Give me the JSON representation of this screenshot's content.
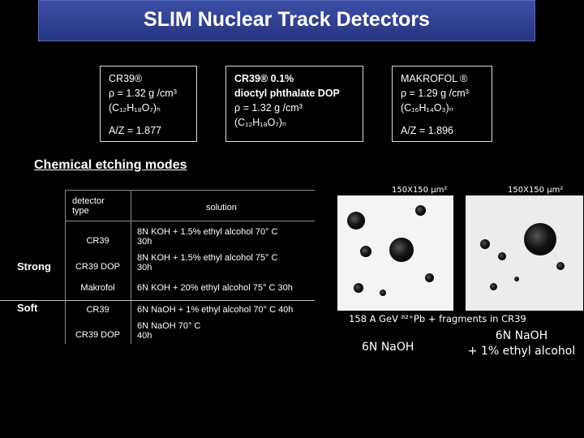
{
  "title": "SLIM Nuclear Track Detectors",
  "materials": [
    {
      "lines": [
        "CR39®",
        "ρ = 1.32 g /cm³",
        "(C₁₂H₁₈O₇)ₙ",
        "",
        "A/Z = 1.877"
      ]
    },
    {
      "lines": [
        "CR39® 0.1%",
        "dioctyl phthalate DOP",
        "ρ = 1.32 g /cm³",
        "(C₁₂H₁₈O₇)ₙ"
      ]
    },
    {
      "lines": [
        "MAKROFOL ®",
        "ρ = 1.29 g /cm³",
        "(C₁₆H₁₄O₃)ₙ",
        "",
        "A/Z = 1.896"
      ]
    }
  ],
  "etching_heading": "Chemical etching modes",
  "table": {
    "header_detector": "detector\ntype",
    "header_solution": "solution",
    "groups": [
      "Strong",
      "Soft"
    ],
    "rows": [
      {
        "detector": "CR39",
        "solution": "8N KOH + 1.5% ethyl alcohol 70° C\n30h"
      },
      {
        "detector": "CR39 DOP",
        "solution": "8N KOH + 1.5% ethyl alcohol 75° C\n30h"
      },
      {
        "detector": "Makrofol",
        "solution": "6N KOH + 20% ethyl alcohol 75° C 30h"
      },
      {
        "detector": "CR39",
        "solution": "6N NaOH + 1% ethyl alcohol 70° C 40h"
      },
      {
        "detector": "CR39 DOP",
        "solution": "6N NaOH 70° C\n40h"
      }
    ]
  },
  "photos": {
    "label_left": "150X150 μm²",
    "label_right": "150X150 μm²",
    "caption": "158 A GeV  ⁸²⁺Pb + fragments in CR39",
    "etch_left": "6N NaOH",
    "etch_right": "6N NaOH\n+ 1% ethyl alcohol"
  }
}
